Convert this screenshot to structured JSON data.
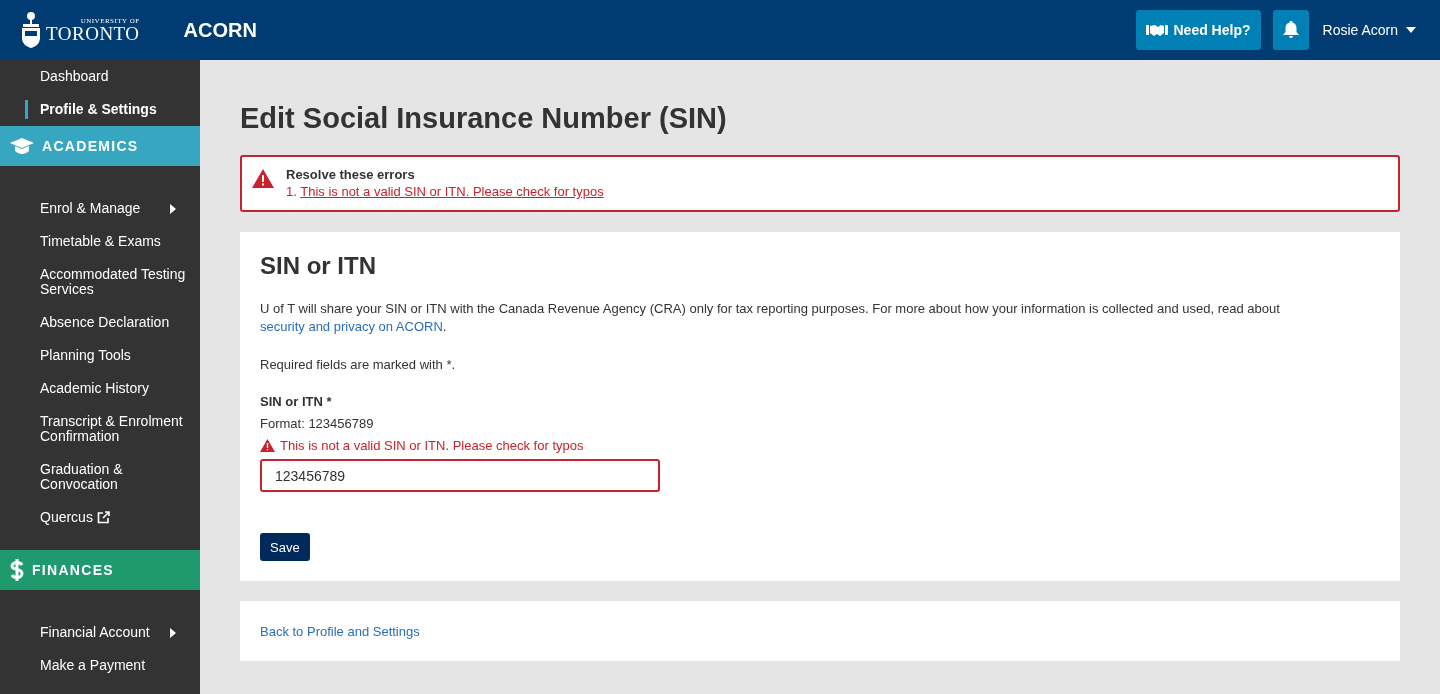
{
  "header": {
    "logo_small": "UNIVERSITY OF",
    "logo_large": "TORONTO",
    "app_name": "ACORN",
    "help_button": "Need Help?",
    "user_name": "Rosie Acorn"
  },
  "sidebar": {
    "top_items": [
      {
        "label": "Dashboard",
        "selected": false
      },
      {
        "label": "Profile & Settings",
        "selected": true
      }
    ],
    "sections": [
      {
        "title": "ACADEMICS",
        "kind": "academics",
        "color": "#37a6c0",
        "items": [
          {
            "label": "Enrol & Manage",
            "submenu": true,
            "external": false
          },
          {
            "label": "Timetable & Exams",
            "submenu": false,
            "external": false
          },
          {
            "label": "Accommodated Testing Services",
            "submenu": false,
            "external": false
          },
          {
            "label": "Absence Declaration",
            "submenu": false,
            "external": false
          },
          {
            "label": "Planning Tools",
            "submenu": false,
            "external": false
          },
          {
            "label": "Academic History",
            "submenu": false,
            "external": false
          },
          {
            "label": "Transcript & Enrolment Confirmation",
            "submenu": false,
            "external": false
          },
          {
            "label": "Graduation & Convocation",
            "submenu": false,
            "external": false
          },
          {
            "label": "Quercus",
            "submenu": false,
            "external": true
          }
        ]
      },
      {
        "title": "FINANCES",
        "kind": "finances",
        "color": "#1f9a6f",
        "items": [
          {
            "label": "Financial Account",
            "submenu": true,
            "external": false
          },
          {
            "label": "Make a Payment",
            "submenu": false,
            "external": false
          }
        ]
      }
    ]
  },
  "page_title": "Edit Social Insurance Number (SIN)",
  "error_summary": {
    "title": "Resolve these errors",
    "errors": [
      {
        "number": "1.",
        "text": "This is not a valid SIN or ITN. Please check for typos"
      }
    ]
  },
  "form_card": {
    "title": "SIN or ITN",
    "intro": {
      "before": "U of T will share your SIN or ITN with the Canada Revenue Agency (CRA) only for tax reporting purposes. For more about how your information is collected and used, read about ",
      "link": "security and privacy on ACORN",
      "after": "."
    },
    "required_note": "Required fields are marked with *.",
    "field": {
      "label": "SIN or ITN *",
      "format": "Format: 123456789",
      "error": "This is not a valid SIN or ITN. Please check for typos",
      "value": "123456789",
      "invalid": true
    },
    "save_button": "Save"
  },
  "back_link": "Back to Profile and Settings"
}
